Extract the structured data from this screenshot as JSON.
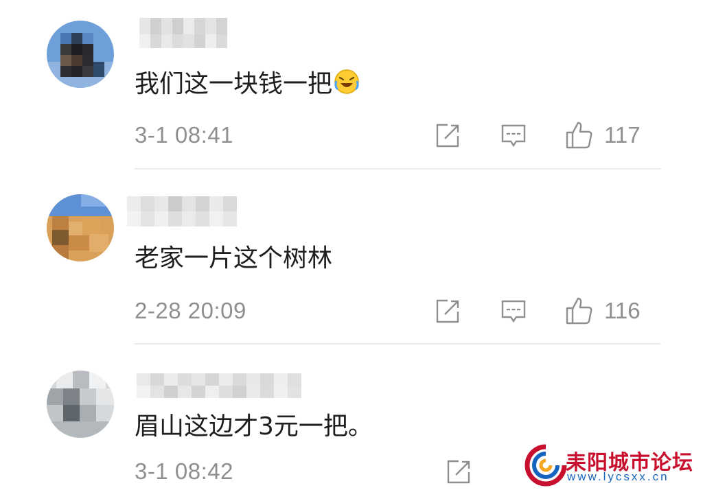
{
  "comments": [
    {
      "text": "我们这一块钱一把",
      "emoji": "laughing-crying-emoji",
      "time": "3-1 08:41",
      "likes": "117"
    },
    {
      "text": "老家一片这个树林",
      "time": "2-28 20:09",
      "likes": "116"
    },
    {
      "text": "眉山这边才3元一把。",
      "time": "3-1 08:42",
      "likes": ""
    }
  ],
  "icons": {
    "share": "share-icon",
    "reply": "comment-icon",
    "like": "thumbs-up-icon"
  },
  "watermark": {
    "title": "耒阳城市论坛",
    "url": "www.lycsxx.cn"
  },
  "colors": {
    "meta_text": "#8f8f8f",
    "divider": "#ebebeb",
    "watermark_red": "#c8102e",
    "watermark_blue": "#1565c0"
  }
}
